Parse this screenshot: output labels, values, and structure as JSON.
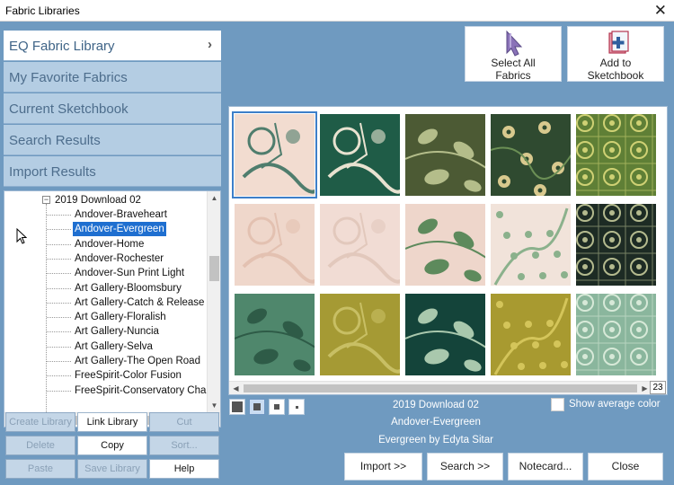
{
  "window": {
    "title": "Fabric Libraries",
    "close_glyph": "✕"
  },
  "categories": [
    {
      "label": "EQ Fabric Library",
      "active": true
    },
    {
      "label": "My Favorite Fabrics"
    },
    {
      "label": "Current Sketchbook"
    },
    {
      "label": "Search Results"
    },
    {
      "label": "Import Results"
    }
  ],
  "tree": {
    "parent": "2019 Download 02",
    "expand_glyph": "−",
    "items": [
      "Andover-Braveheart",
      "Andover-Evergreen",
      "Andover-Home",
      "Andover-Rochester",
      "Andover-Sun Print Light",
      "Art Gallery-Bloomsbury",
      "Art Gallery-Catch & Release",
      "Art Gallery-Floralish",
      "Art Gallery-Nuncia",
      "Art Gallery-Selva",
      "Art Gallery-The Open Road",
      "FreeSpirit-Color Fusion",
      "FreeSpirit-Conservatory Chan"
    ],
    "selected_index": 1
  },
  "library_buttons": {
    "create": "Create Library",
    "link": "Link Library",
    "cut": "Cut",
    "delete": "Delete",
    "copy": "Copy",
    "sort": "Sort...",
    "paste": "Paste",
    "save": "Save Library",
    "help": "Help"
  },
  "toolbar": {
    "select_all": "Select All\nFabrics",
    "add_to_sketchbook": "Add to\nSketchbook"
  },
  "grid": {
    "page": "23",
    "swatches": [
      {
        "name": "swatch-1",
        "bg": "#f2dcd0",
        "fg": "#4f7d6d",
        "pattern": "floral",
        "selected": true
      },
      {
        "name": "swatch-2",
        "bg": "#1f5c47",
        "fg": "#e8e2d0",
        "pattern": "floral"
      },
      {
        "name": "swatch-3",
        "bg": "#4c5a34",
        "fg": "#b4bd8a",
        "pattern": "leaf"
      },
      {
        "name": "swatch-4",
        "bg": "#2f4a30",
        "fg": "#d8c98e",
        "pattern": "flower"
      },
      {
        "name": "swatch-5",
        "bg": "#5f7f36",
        "fg": "#cfd174",
        "pattern": "lattice"
      },
      {
        "name": "swatch-6",
        "bg": "#efd7cb",
        "fg": "#e3c1b1",
        "pattern": "floral"
      },
      {
        "name": "swatch-7",
        "bg": "#f1dcd4",
        "fg": "#e2c8bc",
        "pattern": "floral"
      },
      {
        "name": "swatch-8",
        "bg": "#eed6cb",
        "fg": "#5d8a5c",
        "pattern": "leaf"
      },
      {
        "name": "swatch-9",
        "bg": "#f1e3da",
        "fg": "#8bb18c",
        "pattern": "vine"
      },
      {
        "name": "swatch-10",
        "bg": "#1d2b24",
        "fg": "#b4ba8e",
        "pattern": "lattice"
      },
      {
        "name": "swatch-11",
        "bg": "#4f876c",
        "fg": "#2e5b47",
        "pattern": "leaf"
      },
      {
        "name": "swatch-12",
        "bg": "#a59a34",
        "fg": "#c8bf64",
        "pattern": "floral"
      },
      {
        "name": "swatch-13",
        "bg": "#14443a",
        "fg": "#a9c8ad",
        "pattern": "leaf"
      },
      {
        "name": "swatch-14",
        "bg": "#a89a30",
        "fg": "#d4c55a",
        "pattern": "vine"
      },
      {
        "name": "swatch-15",
        "bg": "#8ab69d",
        "fg": "#d7e9d8",
        "pattern": "lattice"
      }
    ]
  },
  "selection_info": {
    "collection": "2019 Download 02",
    "fabric": "Andover-Evergreen",
    "designer": "Evergreen by Edyta Sitar"
  },
  "show_average": "Show average color",
  "actions": {
    "import": "Import     >>",
    "search": "Search     >>",
    "notecard": "Notecard...",
    "close": "Close"
  }
}
